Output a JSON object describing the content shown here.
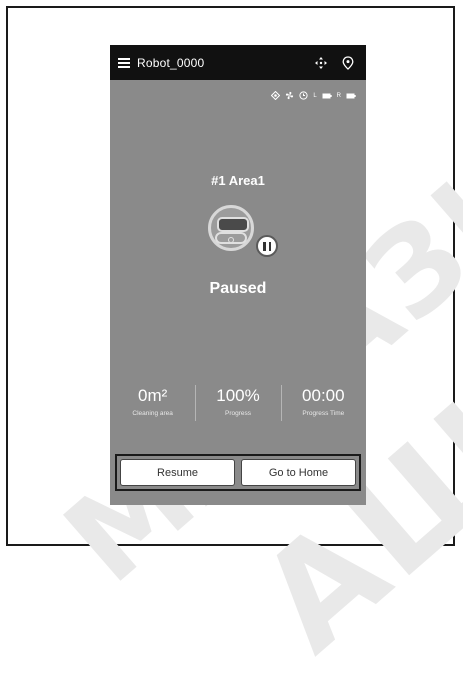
{
  "app": {
    "title": "Robot_0000"
  },
  "icons": {
    "menu": "hamburger-menu-icon",
    "move": "move-arrows-icon",
    "location": "location-pin-icon",
    "status": [
      "target-icon",
      "fan-icon",
      "timer-icon",
      "battery-left-icon",
      "battery-right-icon"
    ]
  },
  "status_bar": {
    "left_label": "L",
    "right_label": "R"
  },
  "area_title": "#1 Area1",
  "status": "Paused",
  "stats": [
    {
      "value": "0m²",
      "label": "Cleaning area"
    },
    {
      "value": "100%",
      "label": "Progress"
    },
    {
      "value": "00:00",
      "label": "Progress Time"
    }
  ],
  "buttons": {
    "resume": "Resume",
    "home": "Go to Home"
  },
  "watermark": {
    "line1": "МАГАЗИН",
    "line2": "АШ"
  }
}
